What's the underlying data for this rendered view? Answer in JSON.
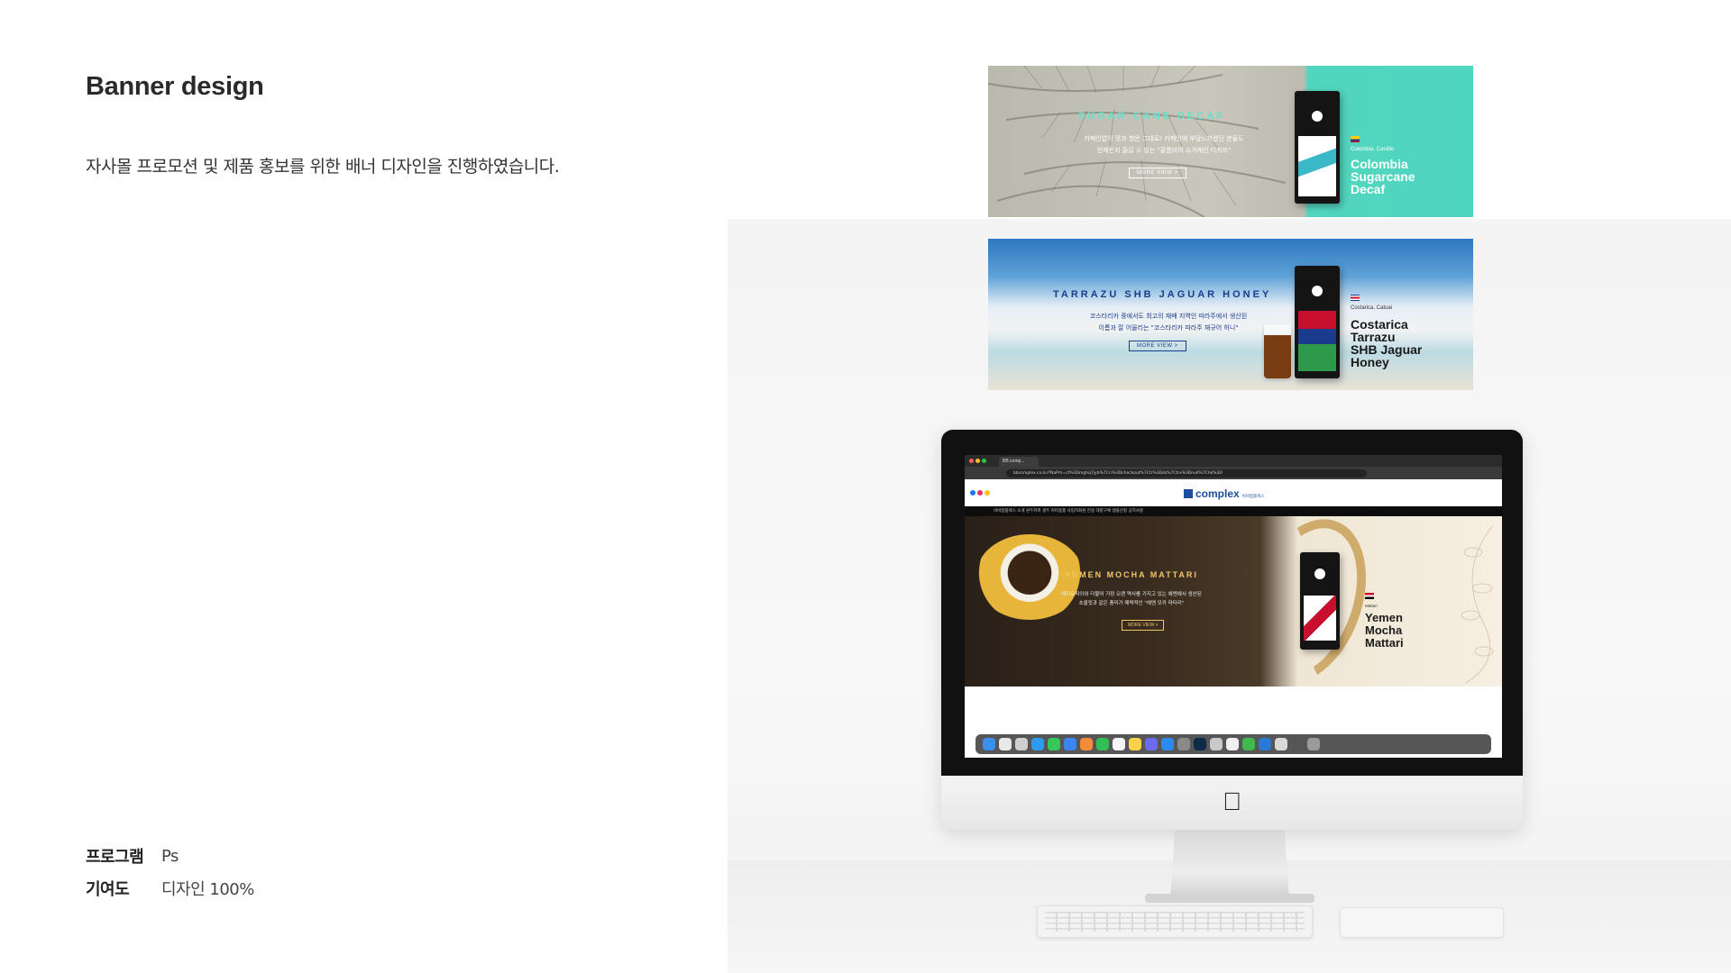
{
  "section": {
    "title": "Banner design",
    "description": "자사몰 프로모션 및 제품 홍보를 위한 배너 디자인을 진행하였습니다."
  },
  "meta": [
    {
      "label": "프로그램",
      "value": "Ps"
    },
    {
      "label": "기여도",
      "value": "디자인 100%"
    }
  ],
  "banner1": {
    "title": "SUGAR CANE DECAF",
    "copy_line1": "카페인없이 맛과 향은 그대로! 카페인에 부담느끼셨던 분들도",
    "copy_line2": "언제든지 즐길 수 있는 \"콜롬비아 슈가케인 디카프\"",
    "button": "MORE VIEW >",
    "origin": "Colombia, Castillo",
    "name_line1": "Colombia",
    "name_line2": "Sugarcane",
    "name_line3": "Decaf",
    "accent_color": "#4fd6c0"
  },
  "banner2": {
    "title": "TARRAZU SHB JAGUAR HONEY",
    "copy_line1": "코스타리카 중에서도 최고의 재배 지역인 따라주에서 생산된",
    "copy_line2": "이름과 잘 어울리는 \"코스타리카 따라주 재규어 허니\"",
    "button": "MORE VIEW >",
    "origin": "Costarica, Catuai",
    "name_line1": "Costarica",
    "name_line2": "Tarrazu",
    "name_line3": "SHB Jaguar",
    "name_line4": "Honey"
  },
  "browser": {
    "tab_label": "BB comp...",
    "url": "bbcomplex.co.kr/?NaPm=ct%3Dmghq7jyb%7Cci%3Dcheckout%7Ctr%3Dds%7Ctrx%3Dnull%7Chk%3D"
  },
  "site": {
    "logo": "complex",
    "logo_sub": "비비컴플렉스",
    "nav": "비비컴플렉스 소개   원두커피   생두   커피용품   사업자회원 전용   대량구매 샘플신청   공지사항"
  },
  "hero": {
    "title": "YEMEN MOCHA MATTARI",
    "copy_line1": "에티오피아와 더불어 가장 오랜 역사를 가지고 있는 예멘에서 생산된",
    "copy_line2": "초콜릿과 같은 풍미가 매력적인 \"예멘 모카 마타리\"",
    "button": "MORE VIEW >",
    "origin": "Mattari",
    "name_line1": "Yemen",
    "name_line2": "Mocha",
    "name_line3": "Mattari"
  },
  "icons": {
    "apple": "apple-logo-icon",
    "dock": "dock-app-icons"
  }
}
